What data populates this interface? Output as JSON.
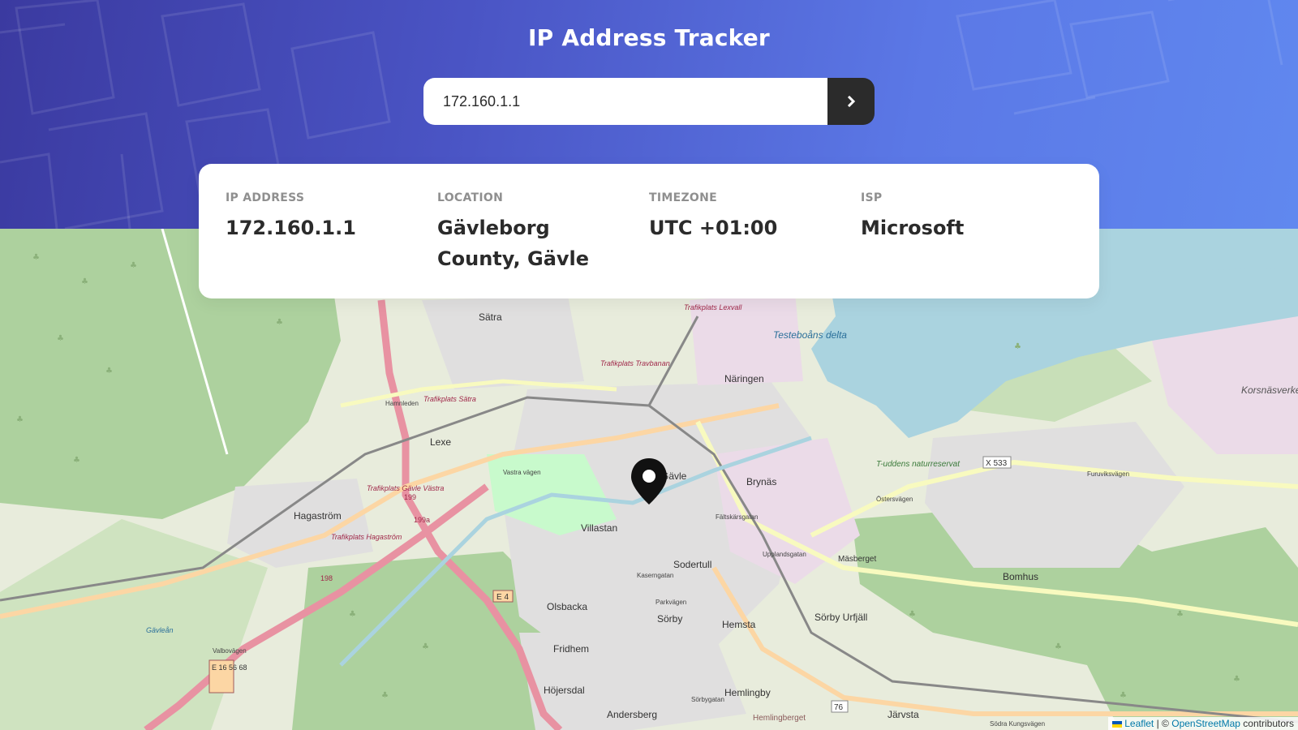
{
  "header": {
    "title": "IP Address Tracker"
  },
  "search": {
    "value": "172.160.1.1",
    "button_icon": "chevron-right-icon"
  },
  "info": {
    "ip": {
      "label": "IP ADDRESS",
      "value": "172.160.1.1"
    },
    "location": {
      "label": "LOCATION",
      "value": "Gävleborg County, Gävle"
    },
    "timezone": {
      "label": "TIMEZONE",
      "value": "UTC +01:00"
    },
    "isp": {
      "label": "ISP",
      "value": "Microsoft"
    }
  },
  "map": {
    "marker_icon": "location-pin-icon",
    "places": [
      "Sätra",
      "Näringen",
      "Testeboåns delta",
      "Lexe",
      "Hagaström",
      "Villastan",
      "Gävle",
      "Brynäs",
      "Sodertull",
      "Olsbacka",
      "Sörby",
      "Hemsta",
      "Sörby Urfjäll",
      "Bomhus",
      "Fridhem",
      "Höjersdal",
      "Hemlingby",
      "Andersberg",
      "Järvsta",
      "Korsnäsverket",
      "Mäsberget",
      "T-uddens naturreservat",
      "Hemlingberget",
      "Gävleån"
    ],
    "roads": [
      "Trafikplats Lexvall",
      "Trafikplats Travbanan",
      "Trafikplats Sätra",
      "Trafikplats Gävle Västra",
      "Trafikplats Hagaström",
      "Hamnleden",
      "Vastra vägen",
      "Kaserngatan",
      "Parkvägen",
      "Upplandsgatan",
      "Östersvägen",
      "Furuviksvägen",
      "Södra Kungsvägen",
      "Valbovägen",
      "Fältskärsgatan",
      "Sörbygatan"
    ],
    "shields": [
      "E 4",
      "E 16 56 68",
      "X 533",
      "76",
      "198",
      "199",
      "199a"
    ],
    "colors": {
      "water": "#aad3df",
      "forest": "#add19e",
      "residential": "#e0dfdf",
      "industrial": "#ebdbe8",
      "motorway": "#e892a2",
      "primary": "#fcd6a4"
    }
  },
  "attribution": {
    "leaflet": "Leaflet",
    "separator": "| ©",
    "osm": "OpenStreetMap",
    "suffix": "contributors"
  }
}
